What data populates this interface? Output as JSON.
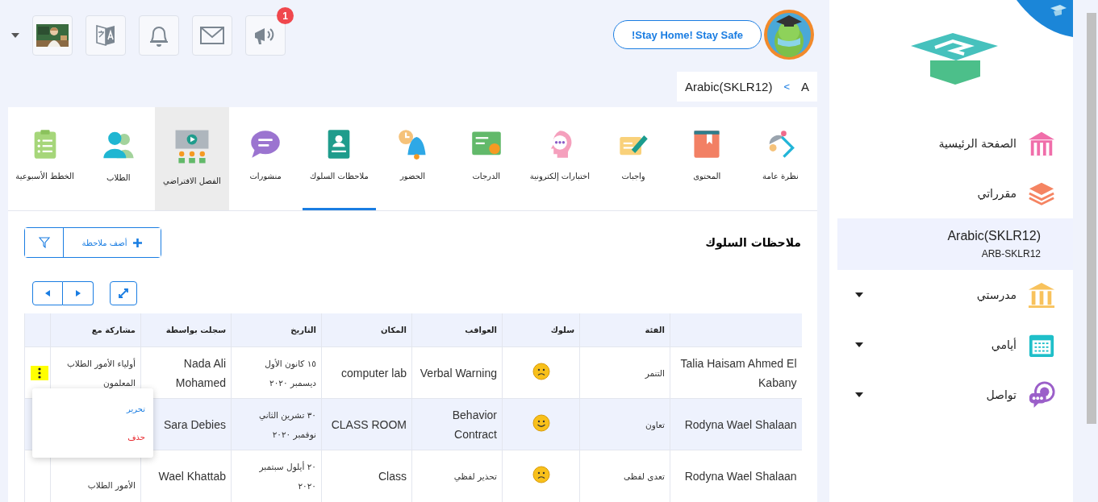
{
  "topbar": {
    "notifications_badge": "1",
    "stay_safe_button": "!Stay Home! Stay Safe"
  },
  "breadcrumb": {
    "items": [
      "A",
      "Arabic(SKLR12)"
    ],
    "separator": ">"
  },
  "tabs": [
    {
      "label": "نظرة عامة",
      "selected": false,
      "highlighted": false
    },
    {
      "label": "المحتوى",
      "selected": false,
      "highlighted": false
    },
    {
      "label": "واجبات",
      "selected": false,
      "highlighted": false
    },
    {
      "label": "اختبارات إلكترونية",
      "selected": false,
      "highlighted": false
    },
    {
      "label": "الدرجات",
      "selected": false,
      "highlighted": false
    },
    {
      "label": "الحضور",
      "selected": false,
      "highlighted": false
    },
    {
      "label": "ملاحظات السلوك",
      "selected": true,
      "highlighted": false
    },
    {
      "label": "منشورات",
      "selected": false,
      "highlighted": false
    },
    {
      "label": "الفصل الافتراضي",
      "selected": false,
      "highlighted": true
    },
    {
      "label": "الطلاب",
      "selected": false,
      "highlighted": false
    },
    {
      "label": "الخطط الأسبوعية",
      "selected": false,
      "highlighted": false
    }
  ],
  "section": {
    "title": "ملاحظات السلوك",
    "add_button": "أضف ملاحظة"
  },
  "table": {
    "columns": [
      "",
      "الفئة",
      "سلوك",
      "العواقب",
      "المكان",
      "التاريخ",
      "سجلت بواسطة",
      "مشاركة مع"
    ],
    "rows": [
      {
        "student": "Talia Haisam Ahmed El Kabany",
        "category": "التنمر",
        "behavior": {
          "kind": "negative"
        },
        "consequence": "Verbal Warning",
        "place": "computer lab",
        "date": [
          "١٥ كانون الأول",
          "ديسمبر ٢٠٢٠"
        ],
        "recorded_by": "Nada Ali Mohamed",
        "shared_with": "أولياء الأمور الطلاب المعلمون",
        "highlighted": false,
        "menu_open": true
      },
      {
        "student": "Rodyna Wael Shalaan",
        "category": "تعاون",
        "behavior": {
          "kind": "positive"
        },
        "consequence": "Behavior Contract",
        "place": "CLASS ROOM",
        "date": [
          "٣٠ تشرين الثاني",
          "نوفمبر ٢٠٢٠"
        ],
        "recorded_by": "Sara Debies",
        "highlighted": true
      },
      {
        "student": "Rodyna Wael Shalaan",
        "category": "تعدى لفظى",
        "behavior": {
          "kind": "negative"
        },
        "consequence": "تحذير لفظي",
        "place": "Class",
        "date": [
          "٢٠ أيلول سبتمبر",
          "٢٠٢٠"
        ],
        "recorded_by": "Wael Khattab",
        "shared_with": "الأمور الطلاب",
        "highlighted": false
      }
    ]
  },
  "row_menu": {
    "items": [
      {
        "label": "تحرير",
        "kind": "edit"
      },
      {
        "label": "حذف",
        "kind": "delete"
      }
    ]
  },
  "sidebar": {
    "items": [
      {
        "label": "الصفحة الرئيسية",
        "kind": "link"
      },
      {
        "label": "مقرراتي",
        "kind": "link"
      },
      {
        "label": "Arabic(SKLR12)",
        "code": "ARB-SKLR12",
        "kind": "course",
        "selected": true
      },
      {
        "label": "مدرستي",
        "kind": "group",
        "expanded": false
      },
      {
        "label": "أيامي",
        "kind": "group",
        "expanded": false
      },
      {
        "label": "تواصل",
        "kind": "group",
        "expanded": false
      }
    ]
  }
}
